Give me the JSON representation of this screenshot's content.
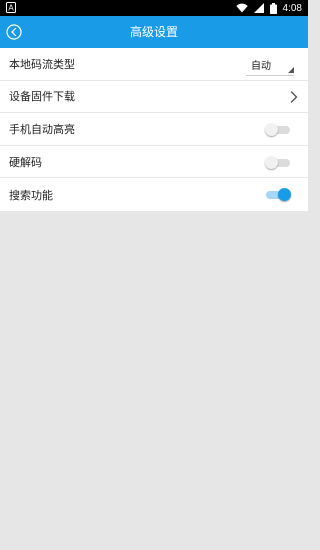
{
  "status_bar": {
    "time": "4:08",
    "left_icon": "a-notification-icon",
    "icons": [
      "wifi-icon",
      "signal-icon",
      "battery-icon"
    ]
  },
  "header": {
    "title": "高级设置",
    "back_icon": "back-icon",
    "color": "#1a9be8"
  },
  "settings": {
    "stream_type": {
      "label": "本地码流类型",
      "value": "自动"
    },
    "firmware_download": {
      "label": "设备固件下载"
    },
    "auto_brightness": {
      "label": "手机自动高亮",
      "enabled": false
    },
    "hardware_decode": {
      "label": "硬解码",
      "enabled": false
    },
    "search_function": {
      "label": "搜索功能",
      "enabled": true
    }
  }
}
